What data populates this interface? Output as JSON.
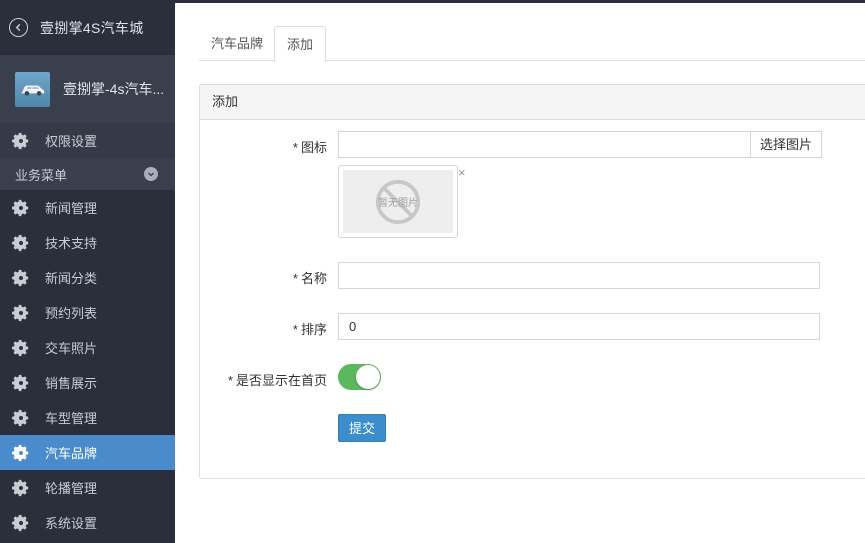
{
  "app": {
    "title": "壹捌掌4S汽车城"
  },
  "profile": {
    "name": "壹捌掌-4s汽车..."
  },
  "sidebar": {
    "permission": "权限设置",
    "group_label": "业务菜单",
    "items": [
      {
        "label": "新闻管理",
        "active": false
      },
      {
        "label": "技术支持",
        "active": false
      },
      {
        "label": "新闻分类",
        "active": false
      },
      {
        "label": "预约列表",
        "active": false
      },
      {
        "label": "交车照片",
        "active": false
      },
      {
        "label": "销售展示",
        "active": false
      },
      {
        "label": "车型管理",
        "active": false
      },
      {
        "label": "汽车品牌",
        "active": true
      },
      {
        "label": "轮播管理",
        "active": false
      },
      {
        "label": "系统设置",
        "active": false
      }
    ]
  },
  "tabs": [
    {
      "label": "汽车品牌",
      "selected": false
    },
    {
      "label": "添加",
      "selected": true
    }
  ],
  "panel": {
    "title": "添加"
  },
  "form": {
    "icon_label": "图标",
    "icon_value": "",
    "pick_image": "选择图片",
    "no_image": "暂无图片",
    "close": "×",
    "name_label": "名称",
    "name_value": "",
    "order_label": "排序",
    "order_value": "0",
    "show_home_label": "是否显示在首页",
    "show_home_on": true,
    "submit": "提交",
    "required_mark": "*"
  },
  "colors": {
    "sidebar_bg": "#2b2f3b",
    "active_item": "#4a8ccb",
    "toggle_on": "#5cb85c",
    "submit_bg": "#3c8dcb"
  }
}
